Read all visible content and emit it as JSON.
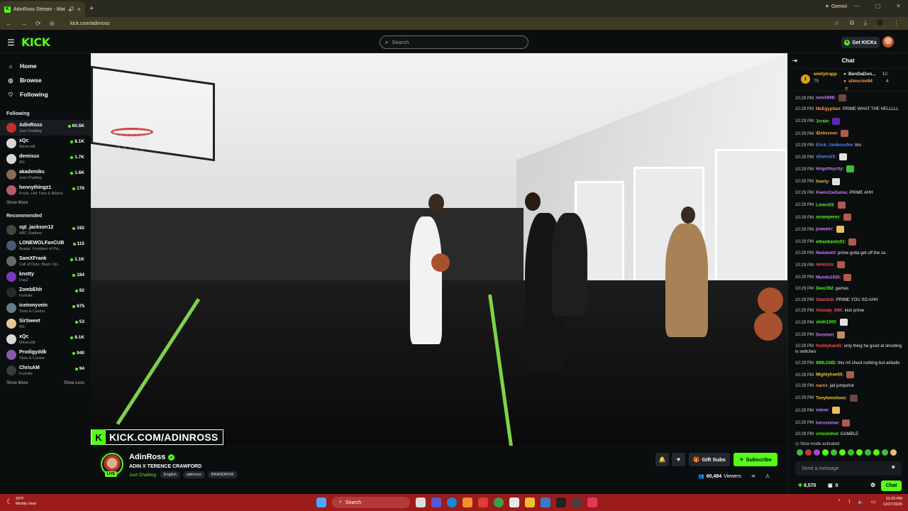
{
  "browser": {
    "tab_title": "AdinRoss Stream - Watch L",
    "url": "kick.com/adinross",
    "gemini_label": "Gemini"
  },
  "nav": {
    "logo": "KICK",
    "search_placeholder": "Search",
    "get_kicks": "Get KICKs"
  },
  "sidebar": {
    "main": [
      {
        "label": "Home",
        "icon": "home-icon"
      },
      {
        "label": "Browse",
        "icon": "compass-icon"
      },
      {
        "label": "Following",
        "icon": "heart-icon"
      }
    ],
    "following_heading": "Following",
    "following": [
      {
        "name": "AdinRoss",
        "category": "Just Chatting",
        "viewers": "60.5K",
        "color": "#c0302a"
      },
      {
        "name": "xQc",
        "category": "Minecraft",
        "viewers": "8.1K",
        "color": "#d8d8d8"
      },
      {
        "name": "demisux",
        "category": "IRL",
        "viewers": "1.7K",
        "color": "#d8d8d8"
      },
      {
        "name": "akademiks",
        "category": "Just Chatting",
        "viewers": "1.6K",
        "color": "#8a6b55"
      },
      {
        "name": "hennythingz1",
        "category": "Pools, Hot Tubs & Bikinis",
        "viewers": "176",
        "color": "#b85a6a"
      }
    ],
    "show_more_following": "Show More",
    "recommended_heading": "Recommended",
    "recommended": [
      {
        "name": "sgt_jackson12",
        "category": "ARC Raiders",
        "viewers": "192",
        "color": "#3f4a3a"
      },
      {
        "name": "LONEWOLFanCUB",
        "category": "Avatar: Frontiers of Pa...",
        "viewers": "115",
        "color": "#4a5a72"
      },
      {
        "name": "SamXFrank",
        "category": "Call of Duty: Black Op...",
        "viewers": "1.1K",
        "color": "#6a6a6a"
      },
      {
        "name": "knotty",
        "category": "DayZ",
        "viewers": "184",
        "color": "#7a3ac0"
      },
      {
        "name": "ZombEhh",
        "category": "Fortnite",
        "viewers": "82",
        "color": "#2a2a2a"
      },
      {
        "name": "iceinmyvein",
        "category": "Slots & Casino",
        "viewers": "675",
        "color": "#6a7a8a"
      },
      {
        "name": "SirSweet",
        "category": "IRL",
        "viewers": "53",
        "color": "#e8c890"
      },
      {
        "name": "xQc",
        "category": "Minecraft",
        "viewers": "8.1K",
        "color": "#d8d8d8"
      },
      {
        "name": "Prodigyddk",
        "category": "Slots & Casino",
        "viewers": "940",
        "color": "#8a5ab0"
      },
      {
        "name": "ChrisAM",
        "category": "Fortnite",
        "viewers": "94",
        "color": "#3a3a3a"
      }
    ],
    "show_more_recommended": "Show More",
    "show_less": "Show Less"
  },
  "video": {
    "overlay_text": "KICK.COM/ADINROSS"
  },
  "channel": {
    "name": "AdinRoss",
    "live_badge": "LIVE",
    "stream_title": "ADIN X TERENCE CRAWFORD",
    "category": "Just Chatting",
    "tags": [
      "English",
      "adinross",
      "BRANDRISK"
    ],
    "gift_subs": "Gift Subs",
    "subscribe": "Subscribe",
    "viewer_count": "60,484",
    "viewers_label": "Viewers"
  },
  "chat": {
    "title": "Chat",
    "leaderboard": [
      {
        "name": "emilytrapp",
        "value": "75",
        "color": "#f4c430"
      },
      {
        "name": "BenDaDon...",
        "value": "10",
        "color": "#ffffff"
      },
      {
        "name": "slimcrim94",
        "value": "4",
        "color": "#ff9a3c"
      }
    ],
    "leader_rank": "1",
    "messages": [
      {
        "time": "10:29 PM",
        "user": "neish998",
        "color": "#c77dff",
        "text": "",
        "emote": "#6a4a3a"
      },
      {
        "time": "10:29 PM",
        "user": "MsEgyptian",
        "color": "#ff9a3c",
        "text": "PRIME WHAT THE HELLLLL",
        "emote": ""
      },
      {
        "time": "10:29 PM",
        "user": "Jcrain",
        "color": "#53fc18",
        "text": "",
        "emote": "#5a2ab0"
      },
      {
        "time": "10:29 PM",
        "user": "iBelieveee",
        "color": "#ff9a3c",
        "text": "",
        "emote": "#b05a4a"
      },
      {
        "time": "10:29 PM",
        "user": "Erick_Undersc0re",
        "color": "#4a8aff",
        "text": "bro",
        "emote": ""
      },
      {
        "time": "10:29 PM",
        "user": "xDamo25",
        "color": "#4a8aff",
        "text": "",
        "emote": "#e0e0e0"
      },
      {
        "time": "10:29 PM",
        "user": "kingofmycity",
        "color": "#c77dff",
        "text": "",
        "emote": "#3ac03a"
      },
      {
        "time": "10:29 PM",
        "user": "0verly",
        "color": "#f4c430",
        "text": "",
        "emote": "#e0e0e0"
      },
      {
        "time": "10:29 PM",
        "user": "KeemZoeSama",
        "color": "#c77dff",
        "text": "PRIME AHH",
        "emote": ""
      },
      {
        "time": "10:29 PM",
        "user": "Lmars03",
        "color": "#53fc18",
        "text": "",
        "emote": "#b05a4a"
      },
      {
        "time": "10:29 PM",
        "user": "asiamperez",
        "color": "#53fc18",
        "text": "",
        "emote": "#b05a4a"
      },
      {
        "time": "10:29 PM",
        "user": "joeweirr",
        "color": "#c77dff",
        "text": "",
        "emote": "#e8c060"
      },
      {
        "time": "10:29 PM",
        "user": "ethanbandz01",
        "color": "#53fc18",
        "text": "",
        "emote": "#b05a4a"
      },
      {
        "time": "10:29 PM",
        "user": "Nedsketit",
        "color": "#c77dff",
        "text": "prime gotta get off the za",
        "emote": ""
      },
      {
        "time": "10:29 PM",
        "user": "denizxm",
        "color": "#ff4a4a",
        "text": "",
        "emote": "#b05a4a"
      },
      {
        "time": "10:29 PM",
        "user": "Mundo1830",
        "color": "#c77dff",
        "text": "",
        "emote": "#b05a4a"
      },
      {
        "time": "10:29 PM",
        "user": "Deez392",
        "color": "#53fc18",
        "text": "games",
        "emote": ""
      },
      {
        "time": "10:29 PM",
        "user": "Slam2nk",
        "color": "#ff4a4a",
        "text": "PRIME YOU SO AHH",
        "emote": ""
      },
      {
        "time": "10:29 PM",
        "user": "Ahoody_69K",
        "color": "#ff4a4a",
        "text": "kick prime",
        "emote": ""
      },
      {
        "time": "10:29 PM",
        "user": "sloth1300",
        "color": "#53fc18",
        "text": "",
        "emote": "#e0e0e0"
      },
      {
        "time": "10:29 PM",
        "user": "Donmari",
        "color": "#c77dff",
        "text": "",
        "emote": "#c08a6a"
      },
      {
        "time": "10:29 PM",
        "user": "freddybandz",
        "color": "#ff4a4a",
        "text": "only thing he good at shooting is switches",
        "emote": ""
      },
      {
        "time": "10:29 PM",
        "user": "999LGND",
        "color": "#53fc18",
        "text": "this mf shoot nothing but airballs",
        "emote": ""
      },
      {
        "time": "10:29 PM",
        "user": "Mightyhoe55",
        "color": "#f4c430",
        "text": "",
        "emote": "#b05a4a"
      },
      {
        "time": "10:29 PM",
        "user": "narxx",
        "color": "#ff9a3c",
        "text": "jail jumpshot",
        "emote": ""
      },
      {
        "time": "10:29 PM",
        "user": "Tonytwoshoes",
        "color": "#f4c430",
        "text": "",
        "emote": "#6a4a3a"
      },
      {
        "time": "10:29 PM",
        "user": "eskoe",
        "color": "#c77dff",
        "text": "",
        "emote": "#e8c060"
      },
      {
        "time": "10:29 PM",
        "user": "karusamae",
        "color": "#c77dff",
        "text": "",
        "emote": "#b05a4a"
      },
      {
        "time": "10:29 PM",
        "user": "crisistohot",
        "color": "#53fc18",
        "text": "GAMBLE",
        "emote": ""
      }
    ],
    "slow_mode": "Slow mode activated",
    "input_placeholder": "Send a message",
    "points": "9,570",
    "kicks": "0",
    "chat_button": "Chat"
  },
  "taskbar": {
    "temp": "20°F",
    "weather_desc": "Mostly clear",
    "search": "Search",
    "time": "10:29 PM",
    "date": "12/27/2025"
  },
  "colors": {
    "accent": "#53fc18",
    "bg": "#0b0e0f",
    "taskbar": "#9c1b1b"
  }
}
